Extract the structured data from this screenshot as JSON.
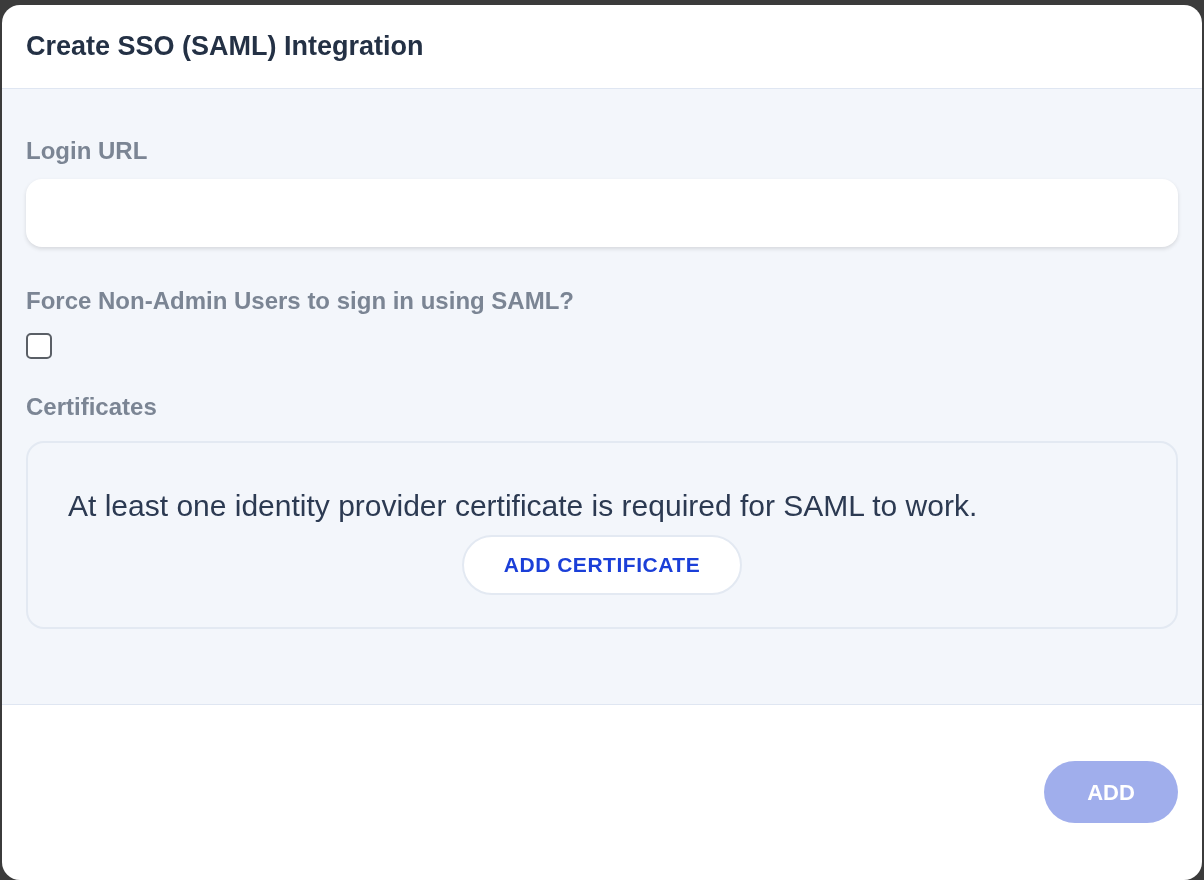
{
  "dialog": {
    "title": "Create SSO (SAML) Integration"
  },
  "login_url": {
    "label": "Login URL"
  },
  "force_saml": {
    "label": "Force Non-Admin Users to sign in using SAML?",
    "checked": false
  },
  "certificates": {
    "label": "Certificates",
    "message": "At least one identity provider certificate is required for SAML to work.",
    "add_button": "ADD CERTIFICATE"
  },
  "footer": {
    "add_button": {
      "label": "ADD",
      "disabled": true
    }
  }
}
